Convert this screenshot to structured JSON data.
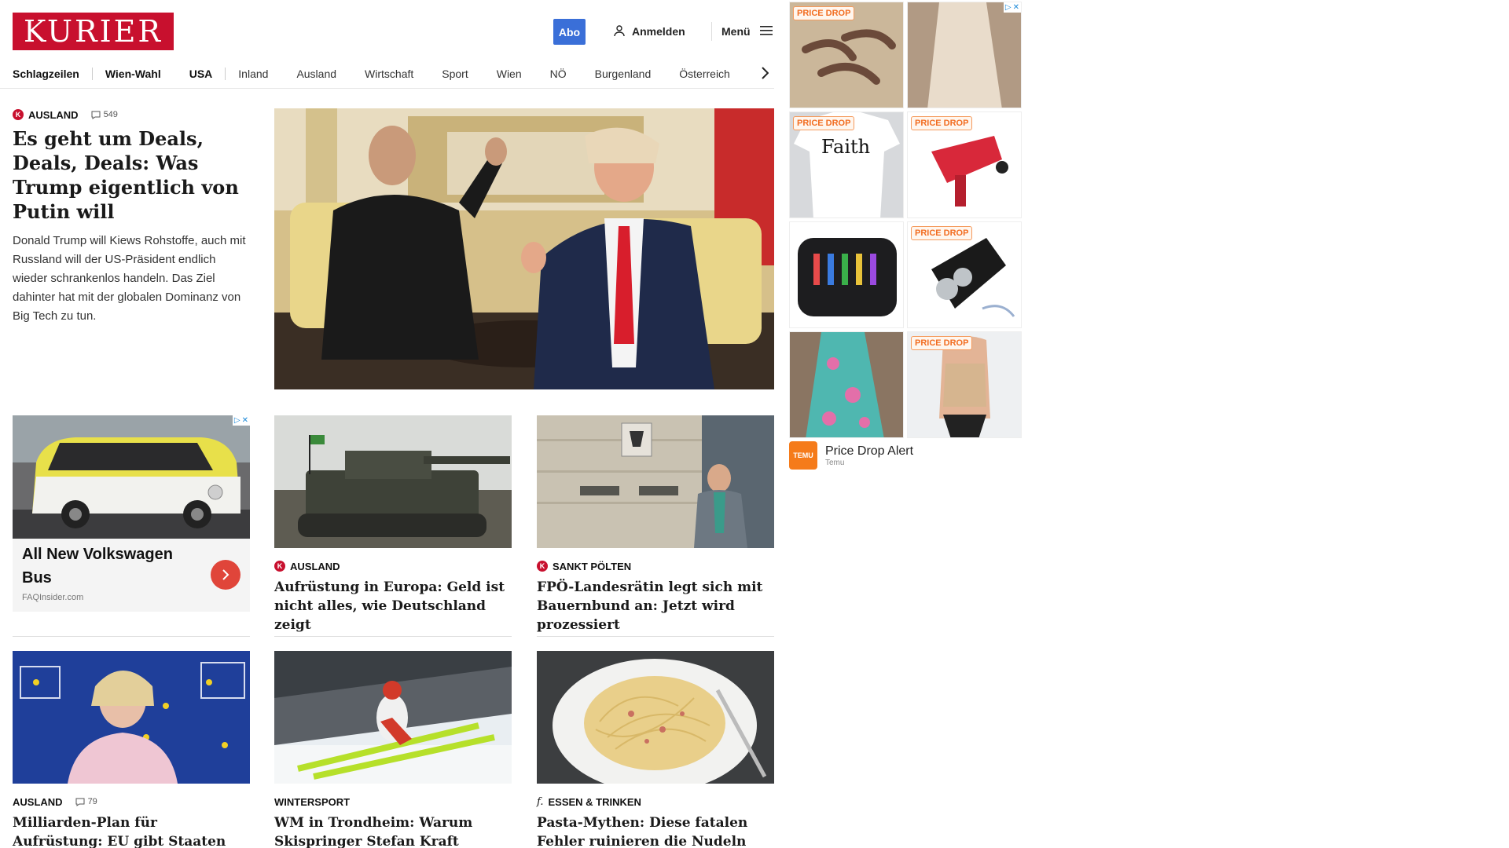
{
  "header": {
    "logo": "KURIER",
    "abo_label": "Abo",
    "login_label": "Anmelden",
    "menu_label": "Menü"
  },
  "nav": {
    "items": [
      "Schlagzeilen",
      "Wien-Wahl",
      "USA",
      "Inland",
      "Ausland",
      "Wirtschaft",
      "Sport",
      "Wien",
      "NÖ",
      "Burgenland",
      "Österreich"
    ]
  },
  "lead": {
    "category": "AUSLAND",
    "comments": "549",
    "headline": "Es geht um Deals, Deals, Deals: Was Trump eigentlich von Putin will",
    "teaser": "Donald Trump will Kiews Rohstoffe, auch mit Russland will der US-Präsident endlich wieder schrankenlos handeln. Das Ziel dahinter hat mit der globalen Dominanz von Big Tech zu tun."
  },
  "vw_ad": {
    "title": "All New Volkswagen Bus",
    "source": "FAQInsider.com"
  },
  "articles": [
    {
      "category": "AUSLAND",
      "headline": "Aufrüstung in Europa: Geld ist nicht alles, wie Deutschland zeigt"
    },
    {
      "category": "SANKT PÖLTEN",
      "headline": "FPÖ-Landesrätin legt sich mit Bauernbund an: Jetzt wird prozessiert"
    },
    {
      "category": "AUSLAND",
      "comments": "79",
      "headline": "Milliarden-Plan für Aufrüstung: EU gibt Staaten freie Bahn für Militärausgaben"
    },
    {
      "category": "WINTERSPORT",
      "headline": "WM in Trondheim: Warum Skispringer Stefan Kraft verzweifelt"
    },
    {
      "category": "ESSEN & TRINKEN",
      "headline": "Pasta-Mythen: Diese fatalen Fehler ruinieren die Nudeln"
    }
  ],
  "ad_grid": {
    "badge": "PRICE DROP",
    "tshirt_text": "Faith",
    "footer_title": "Price Drop Alert",
    "footer_source": "Temu",
    "logo_text": "TEMU"
  },
  "colors": {
    "brand": "#c8102e",
    "abo": "#3a6fd8",
    "badge": "#f26d21"
  }
}
